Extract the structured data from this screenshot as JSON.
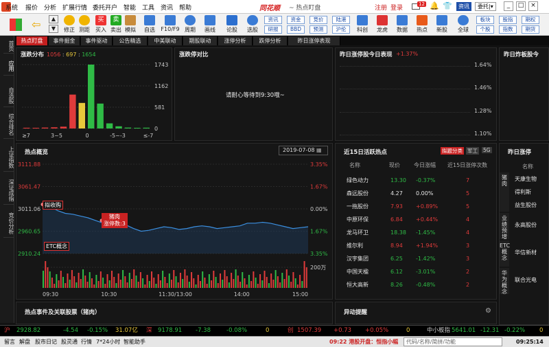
{
  "menu": [
    "系统",
    "报价",
    "分析",
    "扩展行情",
    "委托开户",
    "智能",
    "工具",
    "资讯",
    "帮助"
  ],
  "app_logo": "同花顺",
  "window_title": "热点盯盘",
  "top_right": {
    "register": "注册",
    "login": "登录",
    "mail_badge": "12",
    "news_btn": "资讯",
    "trade_btn": "委托"
  },
  "toolbar": {
    "left": [
      "修正",
      "测距",
      "买入",
      "卖出",
      "模拟",
      "自选",
      "F10/F9",
      "周期",
      "画线",
      "论股",
      "选股"
    ],
    "small": [
      [
        "资讯",
        "资金",
        "竞价",
        "陆港"
      ],
      [
        "研报",
        "BBD",
        "预测",
        "沪伦"
      ]
    ],
    "right": [
      "科创",
      "龙虎",
      "数据",
      "热点",
      "新股",
      "全球"
    ],
    "right_small": [
      [
        "板块",
        "股指",
        "期权"
      ],
      [
        "个股",
        "指数",
        "期货"
      ]
    ]
  },
  "tabs": [
    "热点盯盘",
    "事件掘金",
    "事件驱动",
    "公告精选",
    "中美联动",
    "期股联动",
    "涨停分析",
    "跌停分析",
    "昨日涨停表现"
  ],
  "leftnav": [
    "首页",
    "应用",
    "自选股",
    "综合排名",
    "上证指数",
    "深证成指",
    "竞价分析"
  ],
  "dist": {
    "title": "涨跌分布",
    "up": "1056",
    "flat": "697",
    "down": "1654",
    "y_ticks": [
      "1743",
      "1162",
      "581",
      "0"
    ],
    "x_labels": [
      "≥7",
      "3~5",
      "0",
      "-5~-3",
      "≤-7"
    ],
    "bars": [
      {
        "v": 20,
        "c": "red"
      },
      {
        "v": 18,
        "c": "red"
      },
      {
        "v": 25,
        "c": "red"
      },
      {
        "v": 32,
        "c": "red"
      },
      {
        "v": 50,
        "c": "red"
      },
      {
        "v": 925,
        "c": "red"
      },
      {
        "v": 697,
        "c": "yellow"
      },
      {
        "v": 1743,
        "c": "green"
      },
      {
        "v": 680,
        "c": "green"
      },
      {
        "v": 140,
        "c": "green"
      },
      {
        "v": 60,
        "c": "green"
      },
      {
        "v": 25,
        "c": "green"
      },
      {
        "v": 15,
        "c": "green"
      },
      {
        "v": 22,
        "c": "green"
      }
    ]
  },
  "compare": {
    "title": "涨跌停对比",
    "msg": "请耐心等待到9:30哦~"
  },
  "yest_limit": {
    "title": "昨日涨停股今日表现",
    "value": "+1.37%",
    "y_ticks": [
      "1.64%",
      "1.46%",
      "1.28%",
      "1.10%"
    ]
  },
  "yest_break": {
    "title": "昨日炸板股今"
  },
  "overview": {
    "title": "热点概览",
    "date": "2019-07-08",
    "y_left": [
      "3111.88",
      "3061.47",
      "3011.06",
      "2960.65",
      "2910.24"
    ],
    "y_right": [
      "3.35%",
      "1.67%",
      "0.00%",
      "1.67%",
      "3.35%"
    ],
    "vol_label": "200万",
    "x_ticks": [
      "09:30",
      "10:30",
      "11:30/13:00",
      "14:00",
      "15:00"
    ],
    "tags": [
      "拟收购",
      "ETC概念",
      "猪肉\n涨停数:3"
    ]
  },
  "hot15": {
    "title": "近15日活跃热点",
    "tabs": [
      "拟题分类",
      "军工",
      "5G"
    ],
    "headers": [
      "名称",
      "现价",
      "今日涨幅",
      "近15日涨停次数"
    ],
    "rows": [
      [
        "绿色动力",
        "13.30",
        "-0.37%",
        "7"
      ],
      [
        "森远股份",
        "4.27",
        "0.00%",
        "5"
      ],
      [
        "一拖股份",
        "7.93",
        "+0.89%",
        "5"
      ],
      [
        "中原环保",
        "6.84",
        "+0.44%",
        "4"
      ],
      [
        "龙马环卫",
        "18.38",
        "-1.45%",
        "4"
      ],
      [
        "维尔利",
        "8.94",
        "+1.94%",
        "3"
      ],
      [
        "汉宇集团",
        "6.25",
        "-1.42%",
        "3"
      ],
      [
        "中国天楹",
        "6.12",
        "-3.01%",
        "2"
      ],
      [
        "恒大高新",
        "8.26",
        "-0.48%",
        "2"
      ]
    ]
  },
  "yest_limit_list": {
    "title": "昨日涨停",
    "header": "名称",
    "groups": [
      {
        "cat": "猪肉",
        "items": [
          "天康生物",
          "得利斯",
          "益生股份"
        ]
      },
      {
        "cat": "业绩预增",
        "items": [
          "永高股份"
        ]
      },
      {
        "cat": "ETC概念",
        "items": [
          "华信新材"
        ]
      },
      {
        "cat": "华为概念",
        "items": [
          "联合光电"
        ]
      }
    ]
  },
  "events": {
    "title": "热点事件及关联股票（猪肉）"
  },
  "alerts": {
    "title": "异动提醒"
  },
  "status": {
    "sh_label": "沪",
    "sh": "2928.82",
    "sh_chg": "-4.54",
    "sh_pct": "-0.15%",
    "sh_amt": "31.07亿",
    "sz_label": "深",
    "sz": "9178.91",
    "sz_chg": "-7.38",
    "sz_pct": "-0.08%",
    "sz_amt": "0",
    "cy_label": "创",
    "cy": "1507.39",
    "cy_chg": "+0.73",
    "cy_pct": "+0.05%",
    "cy_amt": "0",
    "zx_label": "中小板指",
    "zx": "5641.01",
    "zx_chg": "-12.31",
    "zx_pct": "-0.22%",
    "zx_amt": "0"
  },
  "bottom": {
    "items": [
      "留言",
      "解盘",
      "股市日记",
      "股灵通",
      "行情",
      "7*24小时",
      "智能助手"
    ],
    "ticker": "09:22 港股开盘：恒指小幅",
    "search_placeholder": "代码/名称/简拼/功能",
    "time": "09:25:14"
  }
}
